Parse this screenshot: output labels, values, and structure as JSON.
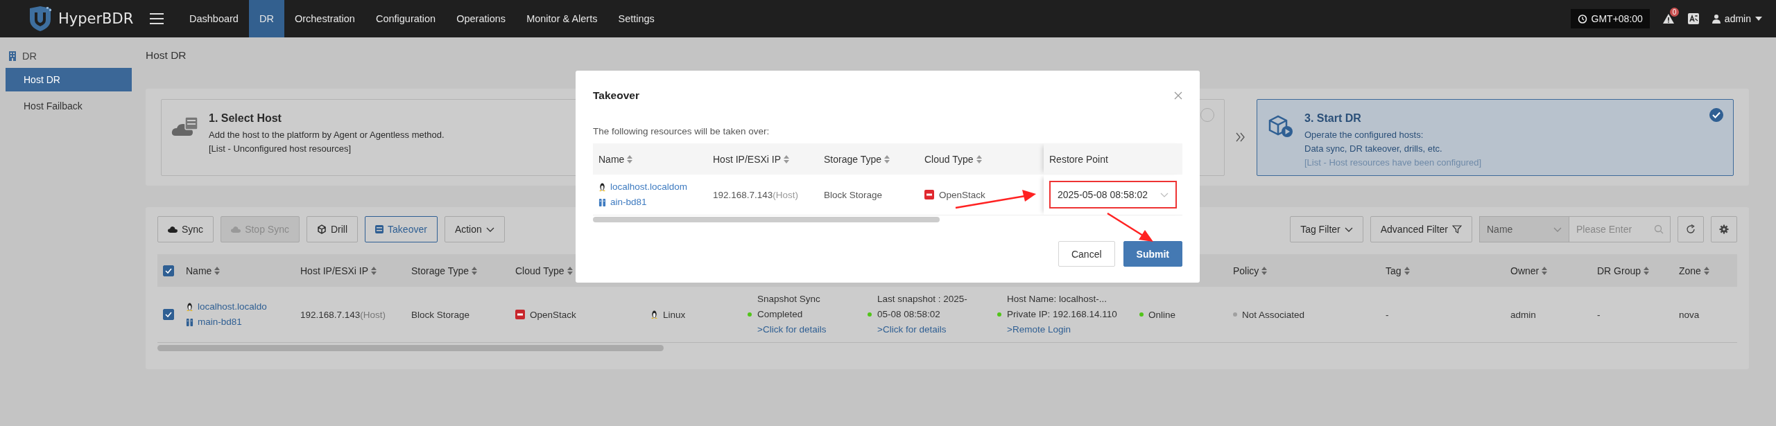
{
  "header": {
    "app_name": "HyperBDR",
    "nav": [
      {
        "label": "Dashboard",
        "selected": false
      },
      {
        "label": "DR",
        "selected": true
      },
      {
        "label": "Orchestration",
        "selected": false
      },
      {
        "label": "Configuration",
        "selected": false
      },
      {
        "label": "Operations",
        "selected": false
      },
      {
        "label": "Monitor & Alerts",
        "selected": false
      },
      {
        "label": "Settings",
        "selected": false
      }
    ],
    "timezone": "GMT+08:00",
    "alert_count": "0",
    "user": "admin"
  },
  "sidebar": {
    "section": "DR",
    "items": [
      {
        "label": "Host DR",
        "selected": true
      },
      {
        "label": "Host Failback",
        "selected": false
      }
    ]
  },
  "page_title": "Host DR",
  "steps": [
    {
      "title": "1. Select Host",
      "lines": [
        "Add the host to the platform by Agent or Agentless method.",
        "[List - Unconfigured host resources]"
      ]
    },
    {
      "selected": false
    },
    {
      "title": "3. Start DR",
      "lines": [
        "Operate the configured hosts:",
        "Data sync, DR takeover, drills, etc.",
        "[List - Host resources have been configured]"
      ],
      "selected": true
    }
  ],
  "toolbar": {
    "buttons": [
      {
        "label": "Sync",
        "disabled": false,
        "primary": false
      },
      {
        "label": "Stop Sync",
        "disabled": true,
        "primary": false
      },
      {
        "label": "Drill",
        "disabled": false,
        "primary": false
      },
      {
        "label": "Takeover",
        "disabled": false,
        "primary": true
      },
      {
        "label": "Action",
        "disabled": false,
        "primary": false
      }
    ],
    "tag_filter": "Tag Filter",
    "advanced_filter": "Advanced Filter",
    "search": {
      "field": "Name",
      "placeholder": "Please Enter"
    }
  },
  "table": {
    "all_checked": true,
    "columns": [
      {
        "label": "Name"
      },
      {
        "label": "Host IP/ESXi IP"
      },
      {
        "label": "Storage Type"
      },
      {
        "label": "Cloud Type"
      },
      {},
      {},
      {},
      {},
      {},
      {
        "label": "Policy"
      },
      {
        "label": "Tag"
      },
      {
        "label": "Owner"
      },
      {
        "label": "DR Group"
      },
      {
        "label": "Zone"
      }
    ],
    "rows": [
      {
        "checked": true,
        "cells": [
          {
            "kind": "name",
            "lines": [
              "localhost.localdo",
              "main-bd81"
            ]
          },
          {
            "kind": "ip",
            "text": "192.168.7.143",
            "note": "(Host)"
          },
          {
            "kind": "text",
            "text": "Block Storage"
          },
          {
            "kind": "cloud",
            "text": "OpenStack"
          },
          {
            "kind": "os",
            "text": "Linux"
          },
          {
            "kind": "lines",
            "lines": [
              {
                "text": "Snapshot Sync",
                "link": false
              },
              {
                "text": "Completed",
                "color": "#52c41a",
                "link": false
              },
              {
                "text": ">Click for details",
                "link": true
              }
            ]
          },
          {
            "kind": "lines",
            "lines": [
              {
                "text": "Last snapshot : 2025-",
                "link": false
              },
              {
                "text": "05-08 08:58:02",
                "color": "#52c41a",
                "link": false
              },
              {
                "text": ">Click for details",
                "link": true
              }
            ]
          },
          {
            "kind": "lines",
            "lines": [
              {
                "text": "Host Name: localhost-...",
                "link": false
              },
              {
                "text": "Private IP: 192.168.14.110",
                "color": "#52c41a",
                "link": false
              },
              {
                "text": ">Remote Login",
                "link": true
              }
            ]
          },
          {
            "kind": "status",
            "text": "Online",
            "color": "#52c41a"
          },
          {
            "kind": "status",
            "text": "Not Associated",
            "color": "#a0a0a0"
          },
          {
            "kind": "text",
            "text": "-"
          },
          {
            "kind": "text",
            "text": "admin"
          },
          {
            "kind": "text",
            "text": "-"
          },
          {
            "kind": "text",
            "text": "nova"
          }
        ]
      }
    ]
  },
  "modal": {
    "title": "Takeover",
    "message": "The following resources will be taken over:",
    "columns": [
      {
        "label": "Name",
        "sortable": true
      },
      {
        "label": "Host IP/ESXi IP",
        "sortable": true
      },
      {
        "label": "Storage Type",
        "sortable": true
      },
      {
        "label": "Cloud Type",
        "sortable": true
      },
      {
        "label": "Restore Point",
        "sortable": false
      }
    ],
    "rows": [
      {
        "cells": [
          {
            "kind": "name",
            "lines": [
              "localhost.localdom",
              "ain-bd81"
            ]
          },
          {
            "kind": "ip",
            "text": "192.168.7.143",
            "note": "(Host)"
          },
          {
            "kind": "text",
            "text": "Block Storage"
          },
          {
            "kind": "cloud",
            "text": "OpenStack"
          },
          {
            "kind": "select",
            "value": "2025-05-08 08:58:02",
            "highlighted": true
          }
        ]
      }
    ],
    "buttons": [
      {
        "label": "Cancel",
        "primary": false
      },
      {
        "label": "Submit",
        "primary": true
      }
    ]
  }
}
